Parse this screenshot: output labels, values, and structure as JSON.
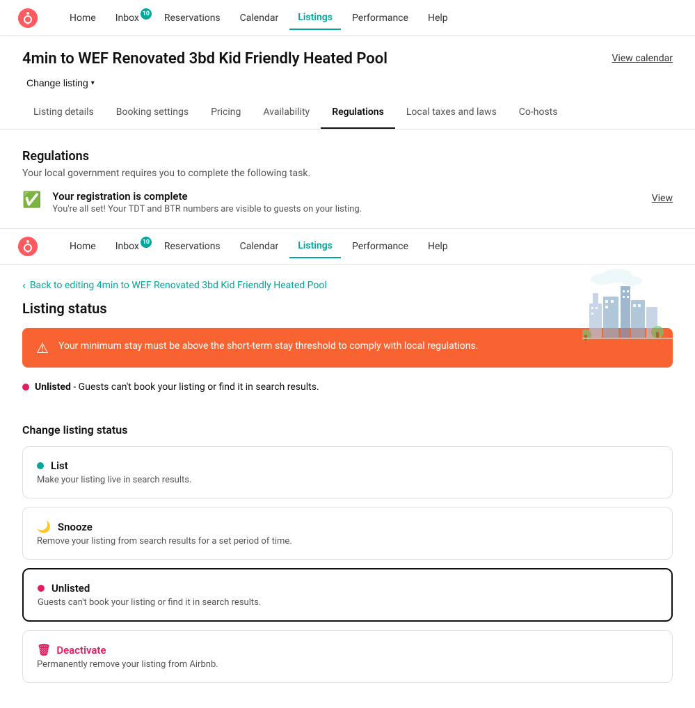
{
  "nav": {
    "links": [
      {
        "label": "Home",
        "active": false,
        "badge": null
      },
      {
        "label": "Inbox",
        "active": false,
        "badge": "10"
      },
      {
        "label": "Reservations",
        "active": false,
        "badge": null
      },
      {
        "label": "Calendar",
        "active": false,
        "badge": null
      },
      {
        "label": "Listings",
        "active": true,
        "badge": null
      },
      {
        "label": "Performance",
        "active": false,
        "badge": null
      },
      {
        "label": "Help",
        "active": false,
        "badge": null
      }
    ]
  },
  "page": {
    "listing_title": "4min to WEF Renovated 3bd Kid Friendly Heated Pool",
    "view_calendar_label": "View calendar",
    "change_listing_label": "Change listing"
  },
  "tabs": [
    {
      "label": "Listing details",
      "active": false
    },
    {
      "label": "Booking settings",
      "active": false
    },
    {
      "label": "Pricing",
      "active": false
    },
    {
      "label": "Availability",
      "active": false
    },
    {
      "label": "Regulations",
      "active": true
    },
    {
      "label": "Local taxes and laws",
      "active": false
    },
    {
      "label": "Co-hosts",
      "active": false
    }
  ],
  "regulations": {
    "title": "Regulations",
    "subtitle": "Your local government requires you to complete the following task.",
    "card_title": "Your registration is complete",
    "card_desc": "You're all set! Your TDT and BTR numbers are visible to guests on your listing.",
    "view_label": "View"
  },
  "back_link": "Back to editing 4min to WEF Renovated 3bd Kid Friendly Heated Pool",
  "listing_status": {
    "title": "Listing status",
    "warning_text": "Your minimum stay must be above the short-term stay threshold to comply with local regulations.",
    "unlisted_label": "Unlisted",
    "unlisted_desc": "- Guests can't book your listing or find it in search results.",
    "change_status_title": "Change listing status",
    "options": [
      {
        "id": "list",
        "icon": "green-dot",
        "title": "List",
        "desc": "Make your listing live in search results.",
        "selected": false
      },
      {
        "id": "snooze",
        "icon": "moon",
        "title": "Snooze",
        "desc": "Remove your listing from search results for a set period of time.",
        "selected": false
      },
      {
        "id": "unlisted",
        "icon": "red-dot",
        "title": "Unlisted",
        "desc": "Guests can't book your listing or find it in search results.",
        "selected": true
      }
    ],
    "deactivate": {
      "title": "Deactivate",
      "desc": "Permanently remove your listing from Airbnb."
    }
  }
}
